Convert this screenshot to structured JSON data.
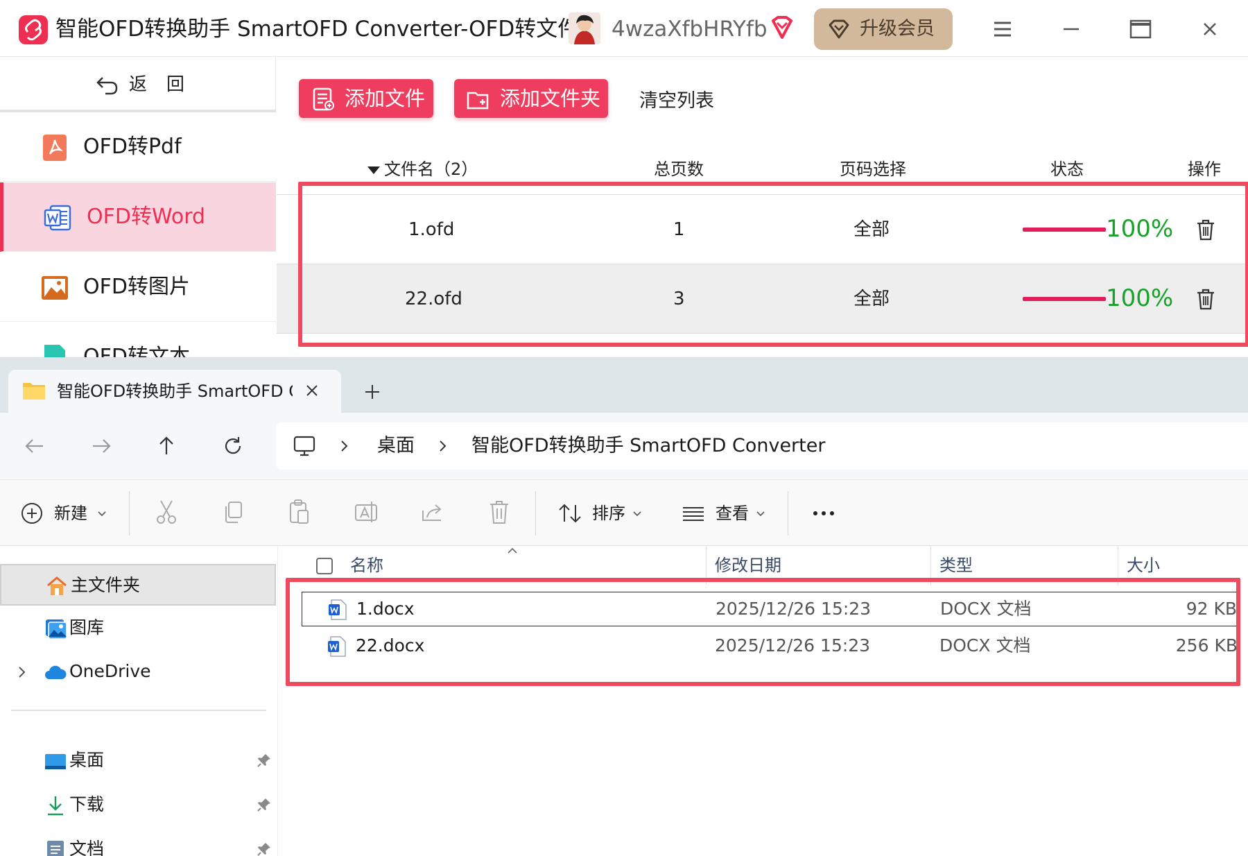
{
  "app": {
    "title": "智能OFD转换助手 SmartOFD Converter-OFD转文件",
    "user_name": "4wzaXfbHRYfb",
    "upgrade_label": "升级会员",
    "back_label": "返回",
    "sidebar": [
      {
        "label": "OFD转Pdf",
        "icon": "pdf-icon",
        "active": false
      },
      {
        "label": "OFD转Word",
        "icon": "word-icon",
        "active": true
      },
      {
        "label": "OFD转图片",
        "icon": "image-icon",
        "active": false
      },
      {
        "label": "OFD转文本",
        "icon": "text-icon",
        "active": false
      }
    ],
    "toolbar": {
      "add_file": "添加文件",
      "add_folder": "添加文件夹",
      "clear_list": "清空列表"
    },
    "table": {
      "headers": {
        "filename": "文件名（2）",
        "pages": "总页数",
        "page_select": "页码选择",
        "status": "状态",
        "action": "操作"
      },
      "rows": [
        {
          "name": "1.ofd",
          "pages": "1",
          "page_select": "全部",
          "progress": 1.0,
          "progress_label": "100%"
        },
        {
          "name": "22.ofd",
          "pages": "3",
          "page_select": "全部",
          "progress": 1.0,
          "progress_label": "100%"
        }
      ]
    },
    "colors": {
      "accent": "#ee2f52",
      "progress": "#e21d5a",
      "done_text": "#17a22a",
      "upgrade": "#d3b99c"
    }
  },
  "explorer": {
    "tab_title": "智能OFD转换助手 SmartOFD Converter",
    "breadcrumb": [
      "桌面",
      "智能OFD转换助手 SmartOFD Converter"
    ],
    "commands": {
      "new": "新建",
      "sort": "排序",
      "view": "查看"
    },
    "nav_items": [
      {
        "label": "主文件夹",
        "icon": "home-icon",
        "selected": true
      },
      {
        "label": "图库",
        "icon": "gallery-icon"
      },
      {
        "label": "OneDrive",
        "icon": "cloud-icon"
      },
      {
        "label": "桌面",
        "icon": "desktop-icon",
        "pinned": true
      },
      {
        "label": "下载",
        "icon": "download-icon",
        "pinned": true
      },
      {
        "label": "文档",
        "icon": "document-icon",
        "pinned": true
      }
    ],
    "columns": {
      "name": "名称",
      "modified": "修改日期",
      "type": "类型",
      "size": "大小"
    },
    "files": [
      {
        "name": "1.docx",
        "modified": "2025/12/26 15:23",
        "type": "DOCX 文档",
        "size": "92 KB"
      },
      {
        "name": "22.docx",
        "modified": "2025/12/26 15:23",
        "type": "DOCX 文档",
        "size": "256 KB"
      }
    ]
  }
}
